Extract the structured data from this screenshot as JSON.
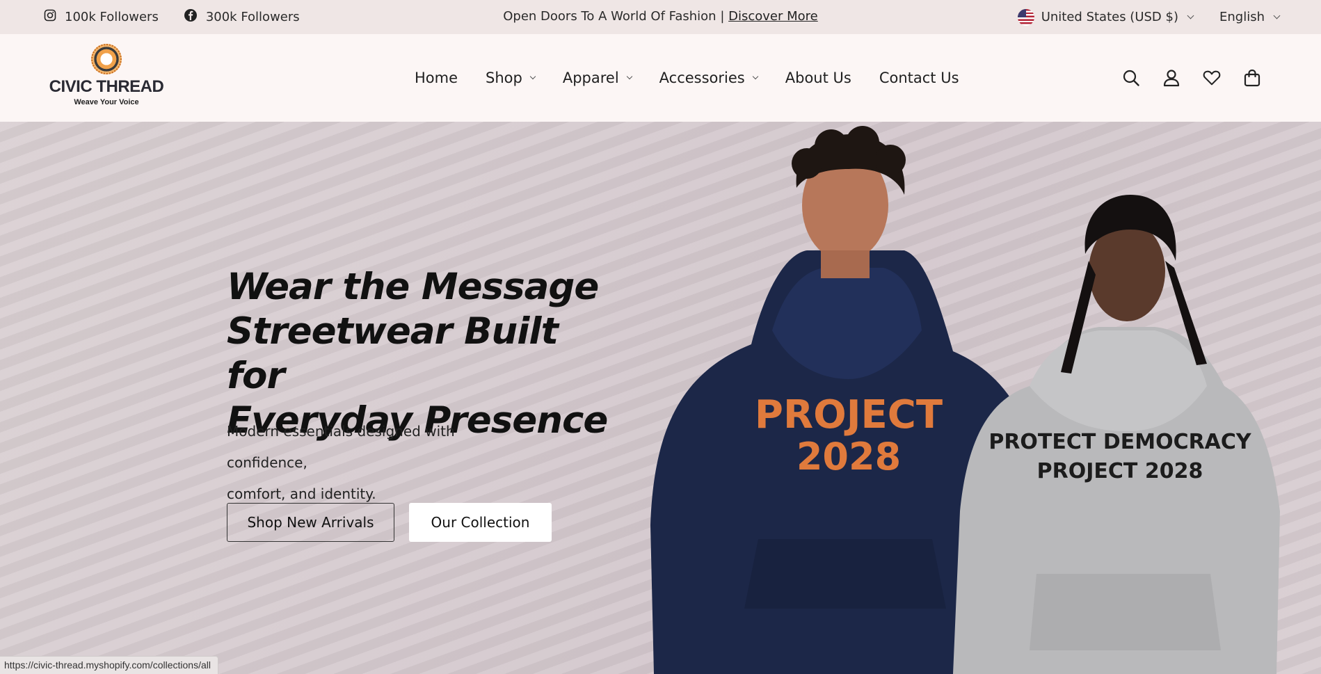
{
  "topbar": {
    "instagram_label": "100k Followers",
    "facebook_label": "300k Followers",
    "announcement": "Open Doors To A World Of Fashion |",
    "discover_link": "Discover More",
    "currency": "United States (USD $)",
    "language": "English"
  },
  "header": {
    "logo_name": "CIVIC THREAD",
    "logo_tagline": "Weave Your Voice",
    "nav": [
      {
        "label": "Home"
      },
      {
        "label": "Shop"
      },
      {
        "label": "Apparel"
      },
      {
        "label": "Accessories"
      },
      {
        "label": "About Us"
      },
      {
        "label": "Contact Us"
      }
    ],
    "icons": [
      "search-icon",
      "account-icon",
      "wishlist-icon",
      "cart-icon"
    ]
  },
  "hero": {
    "title_line1": "Wear the Message",
    "title_line2": "Streetwear Built for",
    "title_line3": "Everyday Presence",
    "subtitle_line1": "Modern essentials designed with confidence,",
    "subtitle_line2": "comfort, and identity.",
    "button_primary": "Shop New Arrivals",
    "button_secondary": "Our Collection",
    "hoodie_left_line1": "PROJECT",
    "hoodie_left_line2": "2028",
    "hoodie_right_line1": "PROTECT DEMOCRACY",
    "hoodie_right_line2": "PROJECT 2028"
  },
  "status_bar": {
    "url": "https://civic-thread.myshopify.com/collections/all"
  },
  "colors": {
    "topbar_bg": "#efe6e5",
    "header_bg": "#fcf6f5",
    "hero_bg": "#d6cbcf",
    "hoodie_navy": "#1c2748",
    "hoodie_grey": "#b9b9bb",
    "accent_orange": "#e07a3c"
  }
}
